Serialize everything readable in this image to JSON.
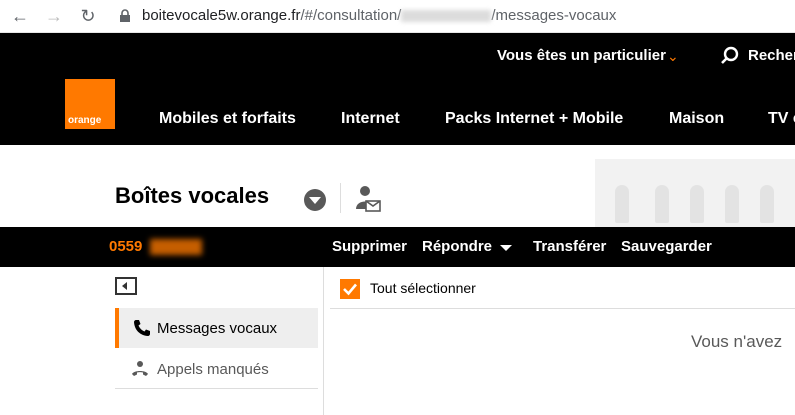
{
  "browser": {
    "url_host": "boitevocale5w.orange.fr",
    "url_path_start": "/#/consultation/",
    "url_path_end": "/messages-vocaux"
  },
  "header": {
    "segment_label": "Vous êtes un particulier",
    "search_label": "Recher",
    "logo_text": "orange",
    "nav": [
      "Mobiles et forfaits",
      "Internet",
      "Packs Internet + Mobile",
      "Maison",
      "TV e"
    ]
  },
  "page": {
    "title": "Boîtes vocales"
  },
  "action_bar": {
    "phone_prefix": "0559",
    "actions": [
      "Supprimer",
      "Répondre",
      "Transférer",
      "Sauvegarder"
    ]
  },
  "sidebar": {
    "items": [
      {
        "label": "Messages vocaux",
        "active": true
      },
      {
        "label": "Appels manqués",
        "active": false
      }
    ]
  },
  "list": {
    "select_all_label": "Tout sélectionner",
    "empty_message": "Vous n'avez"
  },
  "colors": {
    "brand": "#ff7900",
    "header_bg": "#000000"
  }
}
